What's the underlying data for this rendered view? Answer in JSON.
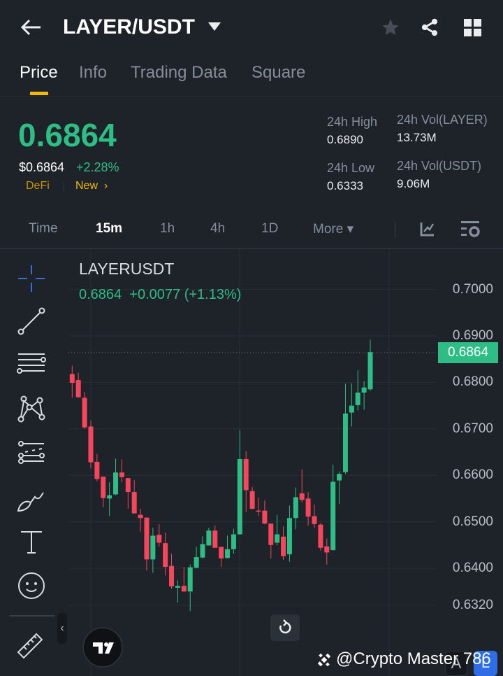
{
  "header": {
    "title": "LAYER/USDT",
    "icons": [
      "back-arrow-icon",
      "caret-down-icon",
      "star-icon",
      "share-icon",
      "grid-icon"
    ]
  },
  "tabs": [
    {
      "label": "Price",
      "active": true
    },
    {
      "label": "Info"
    },
    {
      "label": "Trading Data"
    },
    {
      "label": "Square"
    }
  ],
  "ticker": {
    "price": "0.6864",
    "usd_price": "$0.6864",
    "change": "+2.28%",
    "tag1": "DeFi",
    "tag2": "New",
    "tag2_arrow": "›",
    "high_label": "24h High",
    "high": "0.6890",
    "low_label": "24h Low",
    "low": "0.6333",
    "vol_base_label": "24h Vol(LAYER)",
    "vol_base": "13.73M",
    "vol_quote_label": "24h Vol(USDT)",
    "vol_quote": "9.06M"
  },
  "intervals": {
    "items": [
      "Time",
      "15m",
      "1h",
      "4h",
      "1D",
      "More ▾"
    ],
    "active": "15m"
  },
  "chart": {
    "symbol": "LAYERUSDT",
    "last": "0.6864",
    "change": "+0.0077 (+1.13%)",
    "current_label": "0.6864",
    "watermark": "@Crypto Master 786",
    "btn_a": "A",
    "btn_l": "L",
    "collapse": "‹"
  },
  "colors": {
    "bg": "#1e2229",
    "up": "#2ebd85",
    "down": "#f6465d",
    "accent": "#f0b90b"
  },
  "chart_data": {
    "type": "candlestick",
    "title": "LAYERUSDT 15m",
    "y_ticks": [
      "0.7000",
      "0.6900",
      "0.6800",
      "0.6700",
      "0.6600",
      "0.6500",
      "0.6400",
      "0.6320"
    ],
    "ylim": [
      0.63,
      0.702
    ],
    "current": 0.6864,
    "ohlc": [
      [
        0.6818,
        0.6836,
        0.6767,
        0.6799
      ],
      [
        0.6805,
        0.6821,
        0.6767,
        0.6768
      ],
      [
        0.6767,
        0.6779,
        0.67,
        0.6703
      ],
      [
        0.6705,
        0.6718,
        0.6615,
        0.6628
      ],
      [
        0.6629,
        0.6646,
        0.6587,
        0.6592
      ],
      [
        0.6597,
        0.6597,
        0.6531,
        0.6551
      ],
      [
        0.655,
        0.6585,
        0.6513,
        0.6557
      ],
      [
        0.6559,
        0.6636,
        0.6557,
        0.6606
      ],
      [
        0.6606,
        0.6634,
        0.6585,
        0.6596
      ],
      [
        0.6594,
        0.6594,
        0.6528,
        0.6564
      ],
      [
        0.6564,
        0.659,
        0.6518,
        0.6518
      ],
      [
        0.6515,
        0.6528,
        0.6479,
        0.6508
      ],
      [
        0.6509,
        0.6509,
        0.6395,
        0.6419
      ],
      [
        0.6419,
        0.6487,
        0.639,
        0.647
      ],
      [
        0.6472,
        0.6495,
        0.6446,
        0.6455
      ],
      [
        0.6454,
        0.6477,
        0.6385,
        0.6403
      ],
      [
        0.6405,
        0.6431,
        0.6356,
        0.6361
      ],
      [
        0.6358,
        0.6374,
        0.6326,
        0.6362
      ],
      [
        0.6362,
        0.6403,
        0.6349,
        0.635
      ],
      [
        0.635,
        0.6408,
        0.6308,
        0.6402
      ],
      [
        0.6401,
        0.6446,
        0.64,
        0.6424
      ],
      [
        0.6423,
        0.6469,
        0.6421,
        0.6452
      ],
      [
        0.6449,
        0.6487,
        0.6449,
        0.6481
      ],
      [
        0.6481,
        0.6492,
        0.6444,
        0.6444
      ],
      [
        0.6446,
        0.6446,
        0.6403,
        0.6421
      ],
      [
        0.6422,
        0.647,
        0.6421,
        0.6441
      ],
      [
        0.6441,
        0.6485,
        0.6431,
        0.6473
      ],
      [
        0.6473,
        0.6697,
        0.6472,
        0.6635
      ],
      [
        0.6635,
        0.6652,
        0.6521,
        0.6568
      ],
      [
        0.6566,
        0.6575,
        0.6527,
        0.6528
      ],
      [
        0.6524,
        0.6552,
        0.6513,
        0.6523
      ],
      [
        0.6524,
        0.6546,
        0.6495,
        0.6496
      ],
      [
        0.6496,
        0.6496,
        0.6421,
        0.645
      ],
      [
        0.6455,
        0.6515,
        0.6449,
        0.6473
      ],
      [
        0.6468,
        0.649,
        0.6418,
        0.6426
      ],
      [
        0.643,
        0.6535,
        0.6414,
        0.6508
      ],
      [
        0.6508,
        0.6574,
        0.6484,
        0.6553
      ],
      [
        0.6561,
        0.6613,
        0.6541,
        0.6547
      ],
      [
        0.655,
        0.6564,
        0.6492,
        0.6511
      ],
      [
        0.6512,
        0.6537,
        0.6487,
        0.6495
      ],
      [
        0.6494,
        0.6497,
        0.6438,
        0.6444
      ],
      [
        0.6447,
        0.6464,
        0.6408,
        0.6434
      ],
      [
        0.6439,
        0.6623,
        0.6438,
        0.6586
      ],
      [
        0.6589,
        0.6609,
        0.6538,
        0.6603
      ],
      [
        0.6607,
        0.6797,
        0.6603,
        0.6733
      ],
      [
        0.6735,
        0.6798,
        0.6705,
        0.675
      ],
      [
        0.6751,
        0.6826,
        0.674,
        0.6778
      ],
      [
        0.6778,
        0.6803,
        0.6741,
        0.6789
      ],
      [
        0.6785,
        0.6892,
        0.6782,
        0.6865
      ]
    ]
  }
}
